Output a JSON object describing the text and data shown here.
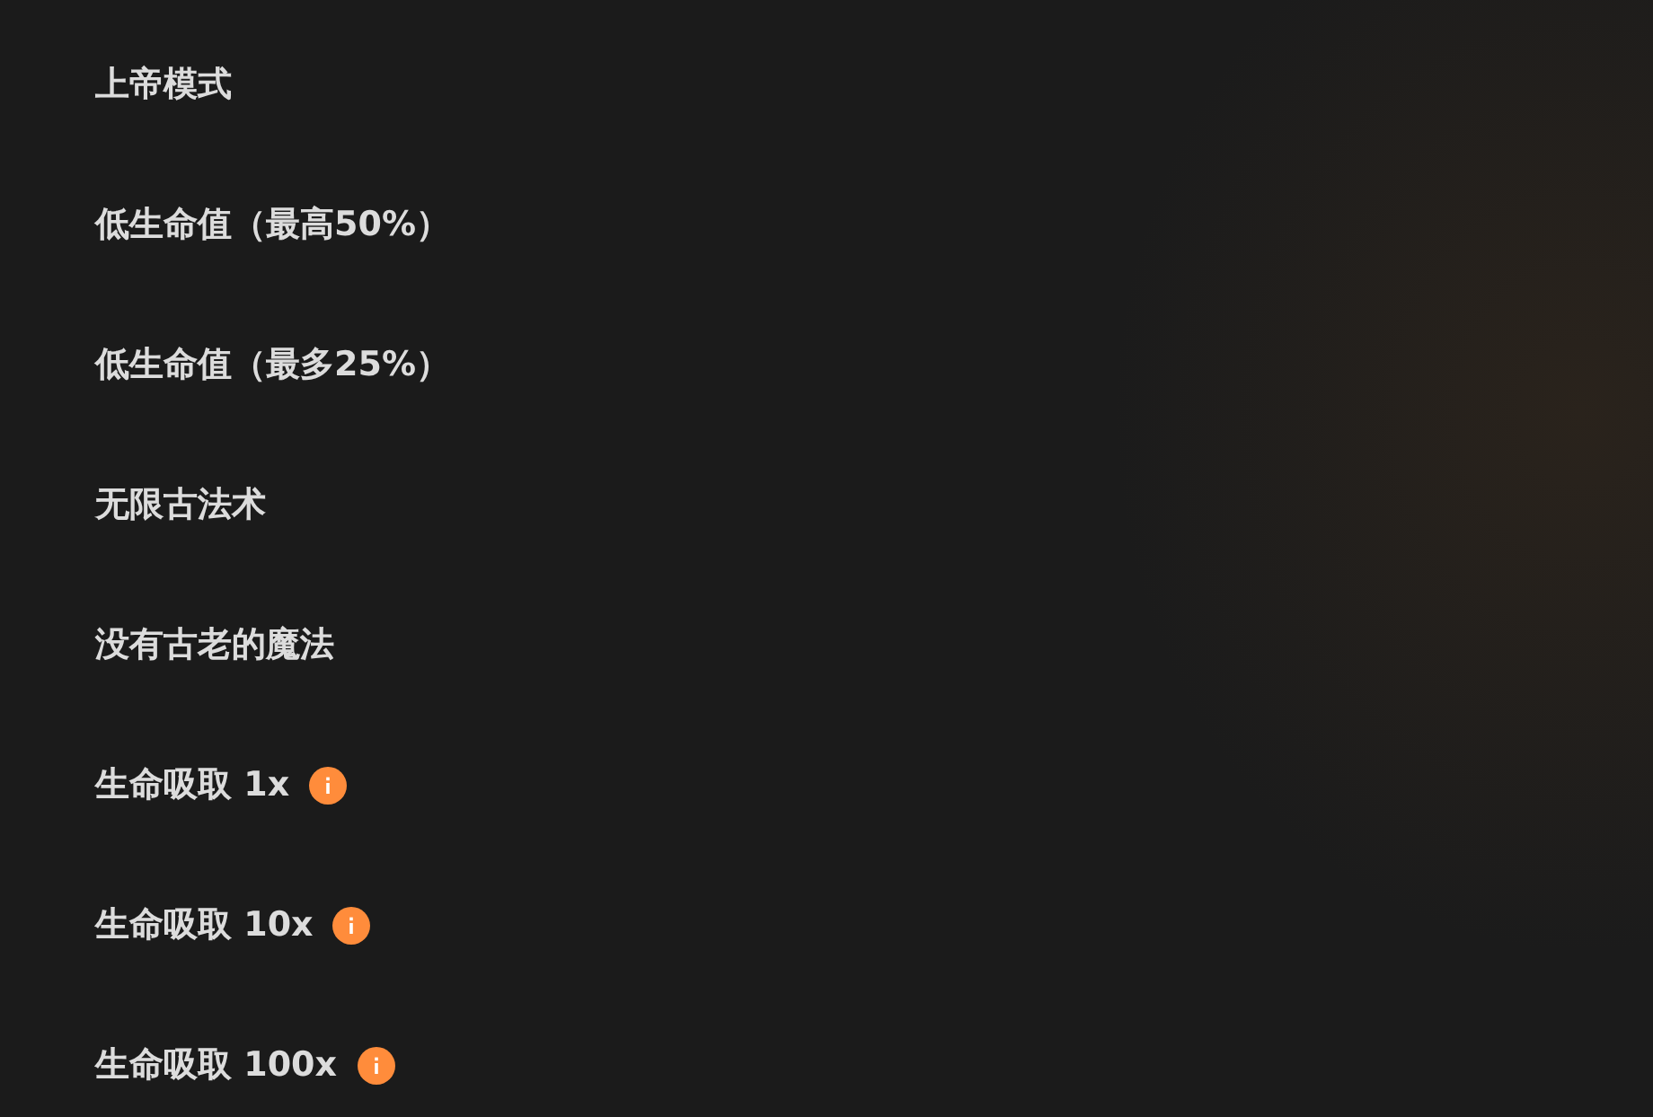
{
  "options": [
    {
      "label": "上帝模式",
      "info": false
    },
    {
      "label": "低生命值（最高50%）",
      "info": false
    },
    {
      "label": "低生命值（最多25%）",
      "info": false
    },
    {
      "label": "无限古法术",
      "info": false
    },
    {
      "label": "没有古老的魔法",
      "info": false
    },
    {
      "label": "生命吸取 1x",
      "info": true
    },
    {
      "label": "生命吸取 10x",
      "info": true
    },
    {
      "label": "生命吸取 100x",
      "info": true
    }
  ]
}
